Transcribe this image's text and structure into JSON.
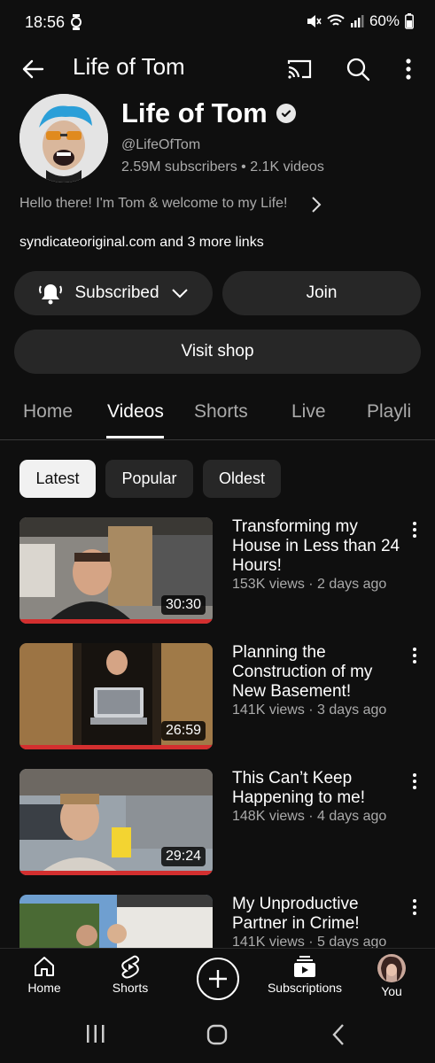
{
  "status": {
    "time": "18:56",
    "battery": "60%"
  },
  "header": {
    "title": "Life of Tom"
  },
  "channel": {
    "name": "Life of Tom",
    "handle": "@LifeOfTom",
    "stats": "2.59M subscribers • 2.1K videos",
    "description": "Hello there! I'm Tom & welcome to my Life!",
    "links": "syndicateoriginal.com and 3 more links"
  },
  "buttons": {
    "subscribed": "Subscribed",
    "join": "Join",
    "shop": "Visit shop"
  },
  "tabs": [
    {
      "label": "Home"
    },
    {
      "label": "Videos"
    },
    {
      "label": "Shorts"
    },
    {
      "label": "Live"
    },
    {
      "label": "Playli"
    }
  ],
  "chips": [
    {
      "label": "Latest"
    },
    {
      "label": "Popular"
    },
    {
      "label": "Oldest"
    }
  ],
  "videos": [
    {
      "title": "Transforming my House in Less than 24 Hours!",
      "meta": "153K views · 2 days ago",
      "duration": "30:30"
    },
    {
      "title": "Planning the Construction of my New Basement!",
      "meta": "141K views · 3 days ago",
      "duration": "26:59"
    },
    {
      "title": "This Can’t Keep Happening to me!",
      "meta": "148K views · 4 days ago",
      "duration": "29:24"
    },
    {
      "title": "My Unproductive Partner in Crime!",
      "meta": "141K views · 5 days ago",
      "duration": ""
    }
  ],
  "nav": {
    "home": "Home",
    "shorts": "Shorts",
    "subscriptions": "Subscriptions",
    "you": "You"
  },
  "colors": {
    "background": "#0f0f0f",
    "chip": "#272727",
    "progress": "#d32f2f"
  }
}
